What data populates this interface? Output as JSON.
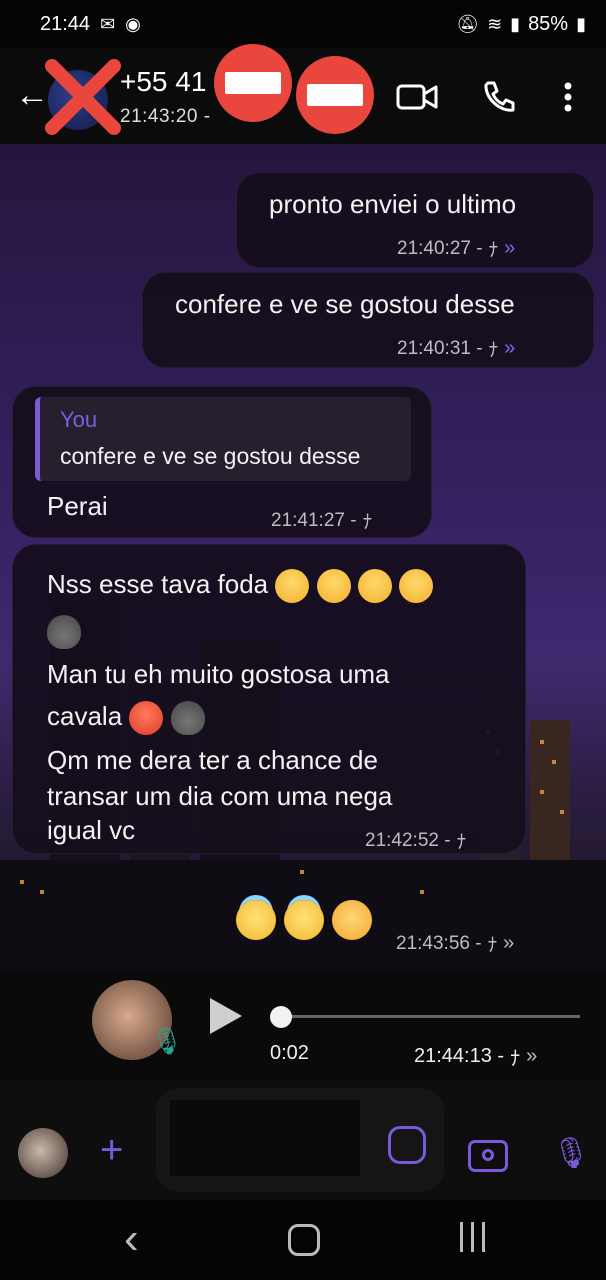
{
  "status_bar": {
    "time": "21:44",
    "battery": "85%"
  },
  "header": {
    "contact_name": "+55 41",
    "last_seen": "21:43:20 -"
  },
  "messages": [
    {
      "text": "pronto enviei o ultimo",
      "time": "21:40:27 - ",
      "direction": "out",
      "status": "read"
    },
    {
      "text": "confere e ve se gostou desse",
      "time": "21:40:31 - ",
      "direction": "out",
      "status": "read"
    },
    {
      "quote_author": "You",
      "quote_text": "confere e ve se gostou desse",
      "text": "Perai",
      "time": "21:41:27 -",
      "direction": "in"
    },
    {
      "lines": [
        "Nss esse tava foda",
        "Man tu eh muito gostosa uma",
        "cavala",
        "Qm me dera ter a chance de",
        "transar um dia com  uma nega",
        "igual vc"
      ],
      "time": "21:42:52 -",
      "direction": "in"
    },
    {
      "emojis": [
        "smiling-face-with-halo",
        "smiling-face-with-halo",
        "smiling-face-with-hearts"
      ],
      "time": "21:43:56 - ",
      "direction": "out",
      "status": "delivered"
    },
    {
      "voice_duration": "0:02",
      "time": "21:44:13 - ",
      "direction": "out",
      "status": "delivered"
    }
  ],
  "colors": {
    "accent": "#7a5ad8",
    "redaction": "#e9473e"
  },
  "icons": {
    "back": "arrow-left-icon",
    "video": "video-camera-icon",
    "call": "phone-icon",
    "more": "kebab-menu-icon"
  }
}
